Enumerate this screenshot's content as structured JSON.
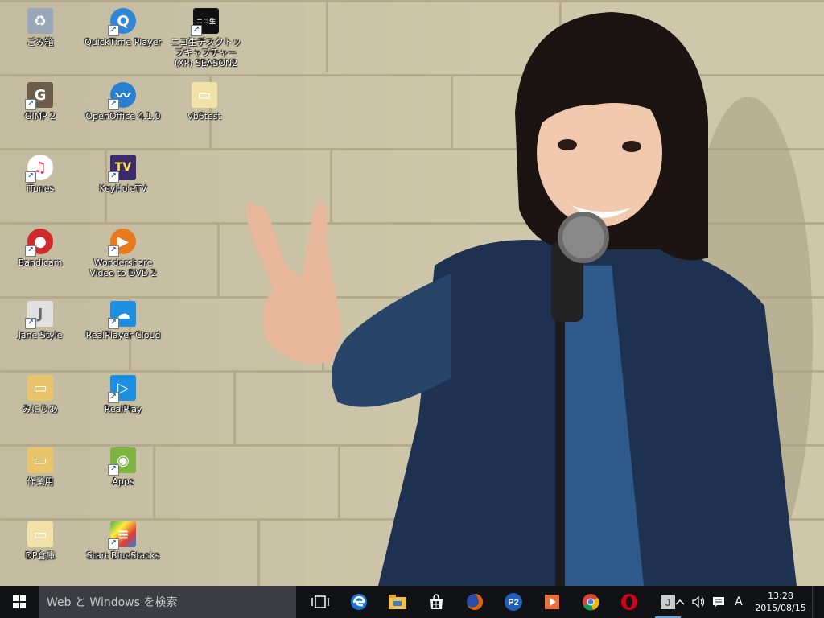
{
  "desktop_icons": [
    {
      "id": "recycle",
      "label": "ごみ箱",
      "icon": "recycle-bin-icon",
      "color": "#9aa7b8"
    },
    {
      "id": "gimp",
      "label": "GIMP 2",
      "icon": "gimp-icon",
      "color": "#6b5c48"
    },
    {
      "id": "itunes",
      "label": "iTunes",
      "icon": "itunes-icon",
      "color": "#e8e8ee"
    },
    {
      "id": "bandicam",
      "label": "Bandicam",
      "icon": "bandicam-icon",
      "color": "#d02a2a"
    },
    {
      "id": "jane",
      "label": "Jane Style",
      "icon": "jane-style-icon",
      "color": "#d8d8d8"
    },
    {
      "id": "mikuria",
      "label": "みにりあ",
      "icon": "folder-icon",
      "color": "#e9c46a"
    },
    {
      "id": "sagyo",
      "label": "作業用",
      "icon": "folder-icon",
      "color": "#e9c46a"
    },
    {
      "id": "dp",
      "label": "DP倉庫",
      "icon": "folder-icon",
      "color": "#e9c46a"
    },
    {
      "id": "quicktime",
      "label": "QuickTime Player",
      "icon": "quicktime-icon",
      "color": "#2f86d4"
    },
    {
      "id": "openoffice",
      "label": "OpenOffice 4.1.0",
      "icon": "openoffice-icon",
      "color": "#2a7fd0"
    },
    {
      "id": "keyhole",
      "label": "KeyHoleTV",
      "icon": "keyholetv-icon",
      "color": "#3b2a6a"
    },
    {
      "id": "wondershare",
      "label": "Wondershare Video to DVD 2",
      "icon": "wondershare-icon",
      "color": "#e87a1b"
    },
    {
      "id": "realcloud",
      "label": "RealPlayer Cloud",
      "icon": "realplayer-cloud-icon",
      "color": "#1e8fe0"
    },
    {
      "id": "realplay",
      "label": "RealPlay",
      "icon": "realplay-icon",
      "color": "#1e8fe0"
    },
    {
      "id": "apps",
      "label": "Apps",
      "icon": "android-apps-icon",
      "color": "#7cb342"
    },
    {
      "id": "bluestacks",
      "label": "Start BlueStacks",
      "icon": "bluestacks-icon",
      "color": "#4caf50"
    },
    {
      "id": "niconama",
      "label": "ニコ生デスクトップキャプチャー(XP) SEASON2",
      "icon": "niconama-icon",
      "color": "#111111",
      "badge": "ニコ生"
    },
    {
      "id": "vb6",
      "label": "vb6test",
      "icon": "folder-icon",
      "color": "#e9c46a"
    }
  ],
  "taskbar": {
    "search_placeholder": "Web と Windows を検索",
    "pinned": [
      {
        "id": "taskview",
        "icon": "task-view-icon"
      },
      {
        "id": "edge",
        "icon": "edge-icon",
        "color": "#1e73d2"
      },
      {
        "id": "explorer",
        "icon": "file-explorer-icon",
        "color": "#f2c14e"
      },
      {
        "id": "store",
        "icon": "store-icon",
        "color": "#ffffff"
      },
      {
        "id": "firefox",
        "icon": "firefox-icon",
        "color": "#e66000"
      },
      {
        "id": "p2",
        "icon": "p2-icon",
        "color": "#1f5fb8",
        "text": "P2"
      },
      {
        "id": "media",
        "icon": "media-player-icon",
        "color": "#e8703a"
      },
      {
        "id": "chrome",
        "icon": "chrome-icon",
        "color": "#db4437"
      },
      {
        "id": "opera",
        "icon": "opera-icon",
        "color": "#d0021b"
      },
      {
        "id": "jane",
        "icon": "jane-style-icon",
        "color": "#cccccc",
        "text": "J"
      }
    ],
    "tray": {
      "ime": "A",
      "time": "13:28",
      "date": "2015/08/15"
    }
  }
}
